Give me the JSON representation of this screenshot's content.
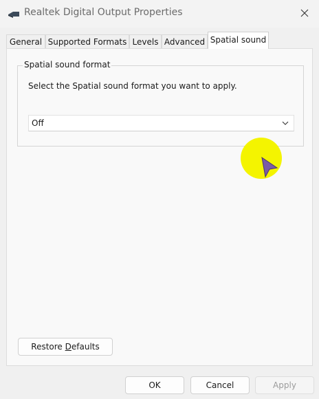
{
  "window": {
    "title": "Realtek Digital Output Properties",
    "icon": "speaker-device-icon",
    "close_icon": "close-icon"
  },
  "tabs": [
    {
      "label": "General",
      "active": false
    },
    {
      "label": "Supported Formats",
      "active": false
    },
    {
      "label": "Levels",
      "active": false
    },
    {
      "label": "Advanced",
      "active": false
    },
    {
      "label": "Spatial sound",
      "active": true
    }
  ],
  "spatial": {
    "group_label": "Spatial sound format",
    "description": "Select the Spatial sound format you want to apply.",
    "format_selected": "Off"
  },
  "restore_label_prefix": "Restore ",
  "restore_label_underlined": "D",
  "restore_label_suffix": "efaults",
  "footer": {
    "ok_label": "OK",
    "cancel_label": "Cancel",
    "apply_label": "Apply",
    "apply_enabled": false
  },
  "colors": {
    "cursor_highlight": "#f4f400",
    "cursor_pointer": "#7b5aa6"
  }
}
